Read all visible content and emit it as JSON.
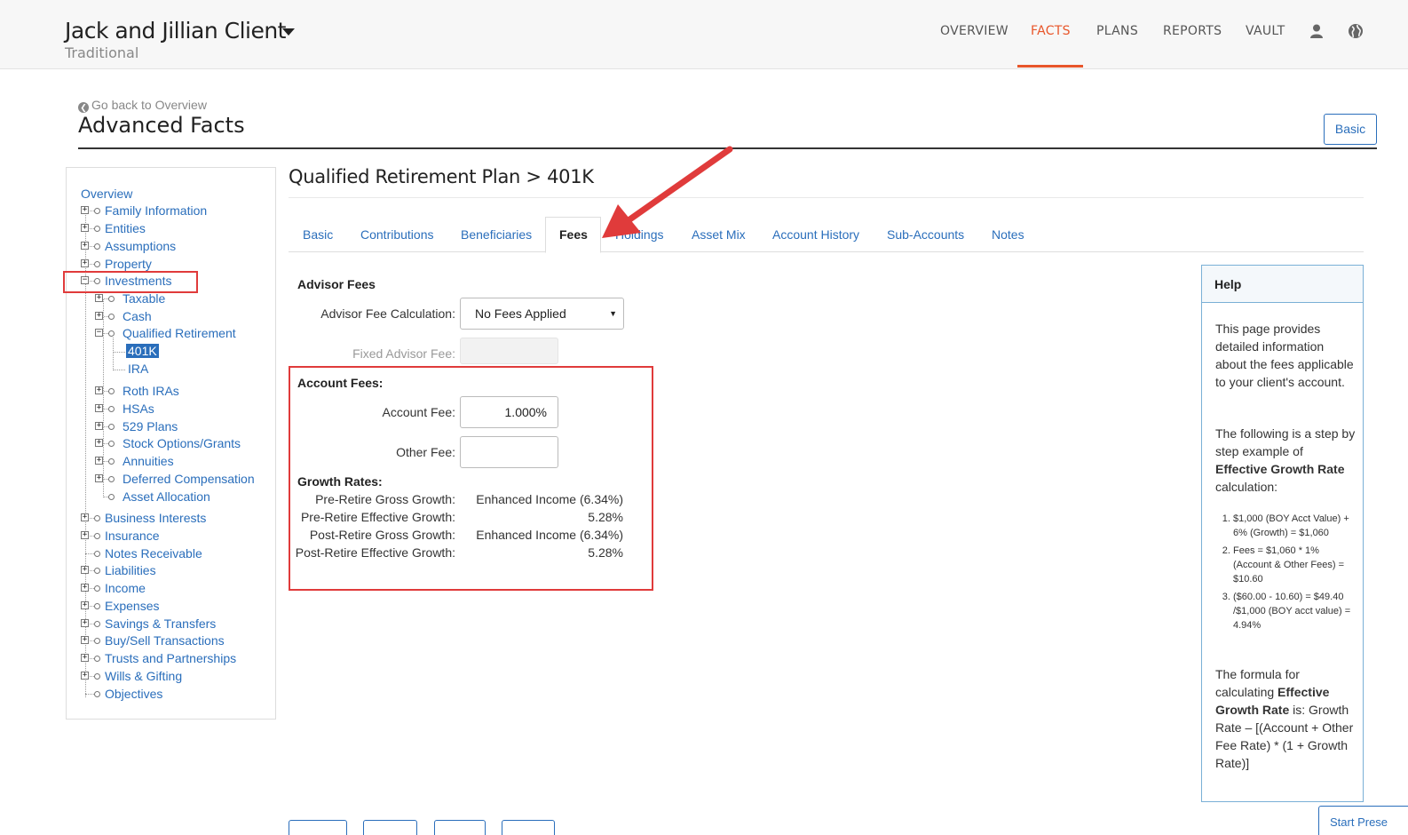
{
  "header": {
    "client_name": "Jack and Jillian Client",
    "client_subtitle": "Traditional",
    "nav": [
      "OVERVIEW",
      "FACTS",
      "PLANS",
      "REPORTS",
      "VAULT"
    ],
    "active_nav": "FACTS",
    "accent_color": "#e8562a"
  },
  "page": {
    "go_back": "Go back to Overview",
    "title": "Advanced Facts",
    "basic_button": "Basic"
  },
  "sidebar": {
    "overview": "Overview",
    "items": [
      "Family Information",
      "Entities",
      "Assumptions",
      "Property",
      "Investments"
    ],
    "investments_children": [
      "Taxable",
      "Cash",
      "Qualified Retirement"
    ],
    "qualified_children": [
      "401K",
      "IRA"
    ],
    "investments_children2": [
      "Roth IRAs",
      "HSAs",
      "529 Plans",
      "Stock Options/Grants",
      "Annuities",
      "Deferred Compensation",
      "Asset Allocation"
    ],
    "items2": [
      "Business Interests",
      "Insurance",
      "Notes Receivable",
      "Liabilities",
      "Income",
      "Expenses",
      "Savings & Transfers",
      "Buy/Sell Transactions",
      "Trusts and Partnerships",
      "Wills & Gifting",
      "Objectives"
    ],
    "selected": "401K"
  },
  "main": {
    "section_title": "Qualified Retirement Plan > 401K",
    "tabs": [
      "Basic",
      "Contributions",
      "Beneficiaries",
      "Fees",
      "Holdings",
      "Asset Mix",
      "Account History",
      "Sub-Accounts",
      "Notes"
    ],
    "active_tab": "Fees",
    "advisor_fees_heading": "Advisor Fees",
    "advisor_fee_calc_label": "Advisor Fee Calculation:",
    "advisor_fee_calc_value": "No Fees Applied",
    "fixed_advisor_fee_label": "Fixed Advisor Fee:",
    "account_fees_heading": "Account Fees:",
    "account_fee_label": "Account Fee:",
    "account_fee_value": "1.000%",
    "other_fee_label": "Other Fee:",
    "other_fee_value": "",
    "growth_heading": "Growth Rates:",
    "growth": [
      {
        "label": "Pre-Retire Gross Growth:",
        "value": "Enhanced Income (6.34%)"
      },
      {
        "label": "Pre-Retire Effective Growth:",
        "value": "5.28%"
      },
      {
        "label": "Post-Retire Gross Growth:",
        "value": "Enhanced Income (6.34%)"
      },
      {
        "label": "Post-Retire Effective Growth:",
        "value": "5.28%"
      }
    ]
  },
  "help": {
    "title": "Help",
    "p1": "This page provides detailed information about the fees applicable to your client's account.",
    "p2_pre": "The following is a step by step example of",
    "p2_bold": "Effective Growth Rate",
    "p2_post": "calculation:",
    "steps": [
      "$1,000 (BOY Acct Value) + 6% (Growth) = $1,060",
      "Fees = $1,060 * 1% (Account & Other Fees) = $10.60",
      "($60.00 - 10.60) = $49.40 /$1,000 (BOY acct value) = 4.94%"
    ],
    "p3_pre": "The formula for calculating",
    "p3_bold": "Effective Growth Rate",
    "p3_post": "is: Growth Rate – [(Account + Other Fee Rate) * (1 + Growth Rate)]"
  },
  "footer": {
    "start_button": "Start Prese"
  },
  "colors": {
    "link": "#2a6ebb",
    "highlight_red": "#e03b3b"
  }
}
